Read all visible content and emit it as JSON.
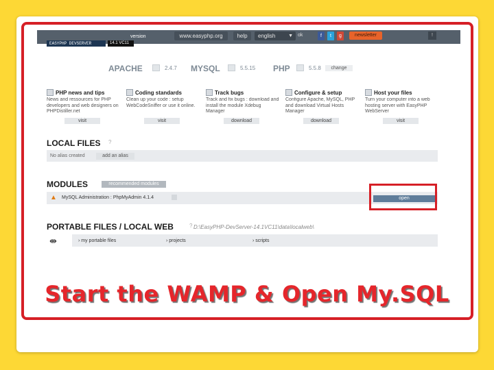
{
  "header": {
    "brand": "EASYPHP DEVSERVER",
    "version_badge": "14.1 VC11",
    "version_label": "version",
    "site": "www.easyphp.org",
    "help": "help",
    "language": "english",
    "language_submit": "ok",
    "social": [
      {
        "label": "f",
        "color": "#3b5998"
      },
      {
        "label": "t",
        "color": "#2aa3dc"
      },
      {
        "label": "g",
        "color": "#d14836"
      }
    ],
    "newsletter": "newsletter",
    "info_icon": "!"
  },
  "versions": [
    {
      "name": "APACHE",
      "version": "2.4.7"
    },
    {
      "name": "MYSQL",
      "version": "5.5.15"
    },
    {
      "name": "PHP",
      "version": "5.5.8",
      "action": "change"
    }
  ],
  "cards": [
    {
      "icon": "news-icon",
      "title": "PHP news and tips",
      "desc": "News and ressources for PHP developers and web designers on PHPDistiller.net",
      "button": "visit"
    },
    {
      "icon": "code-icon",
      "title": "Coding standards",
      "desc": "Clean up your code : setup WebCodeSniffer or use it online.",
      "button": "visit"
    },
    {
      "icon": "bug-icon",
      "title": "Track bugs",
      "desc": "Track and fix bugs : download and install the module Xdebug Manager",
      "button": "download"
    },
    {
      "icon": "gear-icon",
      "title": "Configure & setup",
      "desc": "Configure Apache, MySQL, PHP and download Virtual Hosts Manager",
      "button": "download"
    },
    {
      "icon": "host-icon",
      "title": "Host your files",
      "desc": "Turn your computer into a web hosting server with EasyPHP WebServer",
      "button": "visit"
    }
  ],
  "local_files": {
    "title": "LOCAL FILES",
    "empty_text": "No alias created",
    "add_button": "add an alias"
  },
  "modules": {
    "title": "MODULES",
    "recommended": "recommended modules",
    "items": [
      {
        "name": "MySQL Administration : PhpMyAdmin 4.1.4",
        "action": "open"
      }
    ]
  },
  "portable": {
    "title": "PORTABLE FILES / LOCAL WEB",
    "path": "D:\\EasyPHP-DevServer-14.1VC11\\data\\localweb\\",
    "links": [
      "my portable files",
      "projects",
      "scripts"
    ]
  },
  "caption": "Start the WAMP & Open My.SQL",
  "colors": {
    "background": "#fdd835",
    "highlight": "#d61f26",
    "caption": "#e5262b",
    "topbar": "#55606b"
  }
}
